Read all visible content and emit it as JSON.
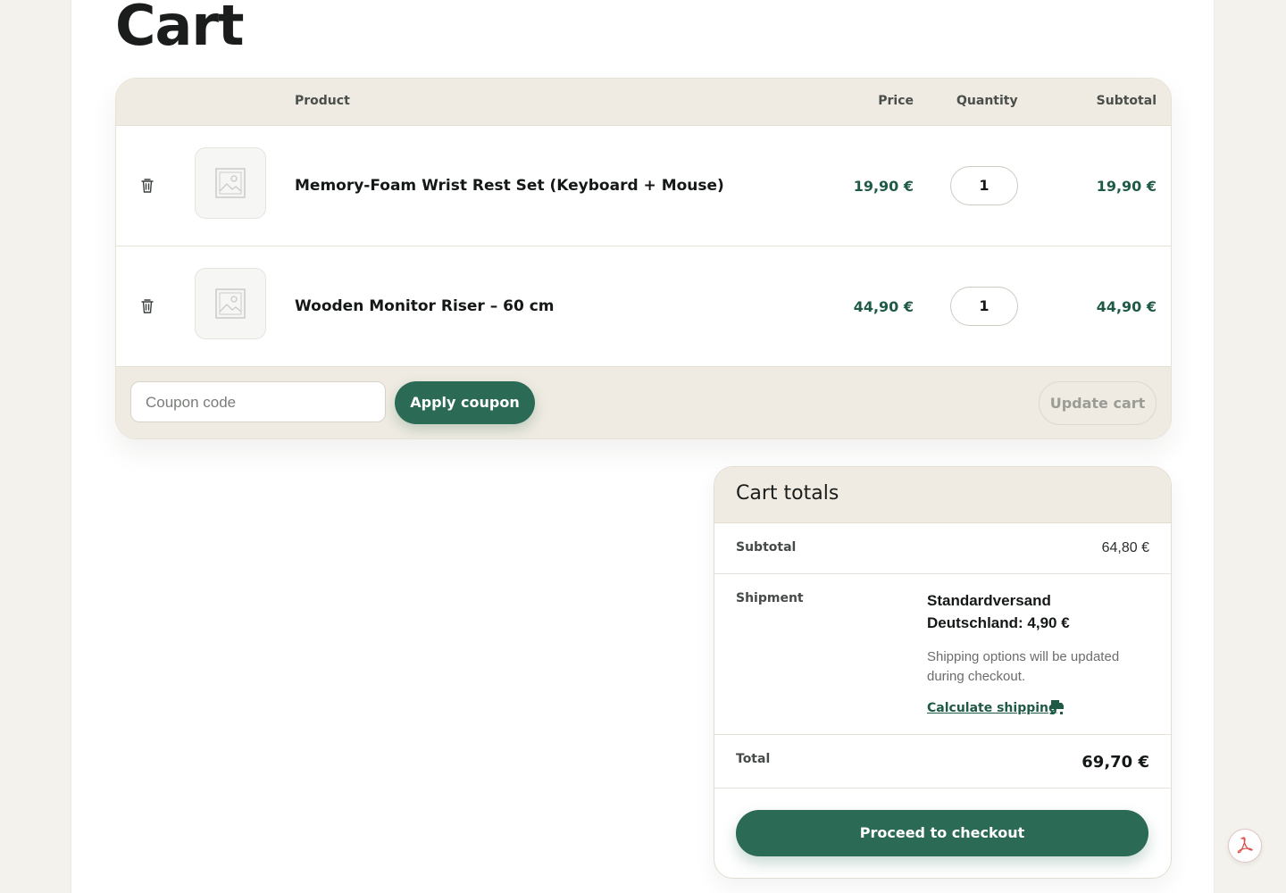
{
  "page": {
    "title": "Cart"
  },
  "cart_table": {
    "headers": {
      "product": "Product",
      "price": "Price",
      "quantity": "Quantity",
      "subtotal": "Subtotal"
    },
    "items": [
      {
        "name": "Memory-Foam Wrist Rest Set (Keyboard + Mouse)",
        "price": "19,90 €",
        "quantity": "1",
        "subtotal": "19,90 €",
        "remove_icon": "trash-icon",
        "thumbnail_icon": "image-placeholder-icon"
      },
      {
        "name": "Wooden Monitor Riser – 60 cm",
        "price": "44,90 €",
        "quantity": "1",
        "subtotal": "44,90 €",
        "remove_icon": "trash-icon",
        "thumbnail_icon": "image-placeholder-icon"
      }
    ],
    "coupon": {
      "placeholder": "Coupon code",
      "value": ""
    },
    "apply_coupon_label": "Apply coupon",
    "update_cart_label": "Update cart"
  },
  "cart_totals": {
    "title": "Cart totals",
    "subtotal_label": "Subtotal",
    "subtotal_value": "64,80 €",
    "shipment_label": "Shipment",
    "shipment_method": "Standardversand Deutschland: 4,90 €",
    "shipment_note": "Shipping options will be updated during checkout.",
    "calculate_shipping_label": "Calculate shipping",
    "calculate_shipping_icon": "truck-icon",
    "total_label": "Total",
    "total_value": "69,70 €",
    "checkout_label": "Proceed to checkout"
  },
  "floating_button": {
    "icon": "acrobat-pdf-icon"
  },
  "colors": {
    "accent": "#2b6a55",
    "price_text": "#1f5a46",
    "header_bg": "#efebe2",
    "page_bg": "#f4f2ec"
  }
}
